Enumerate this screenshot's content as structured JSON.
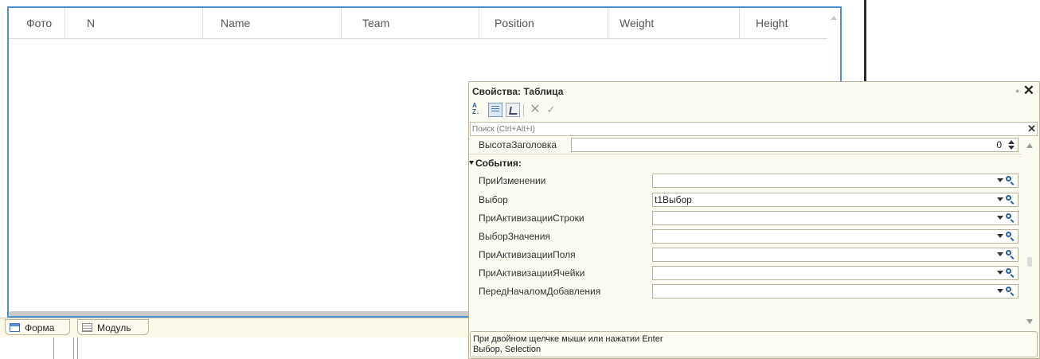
{
  "table": {
    "columns": [
      "Фото",
      "N",
      "Name",
      "Team",
      "Position",
      "Weight",
      "Height"
    ]
  },
  "tabs": {
    "form_label": "Форма",
    "module_label": "Модуль"
  },
  "properties": {
    "title": "Свойства: Таблица",
    "search_placeholder": "Поиск (Ctrl+Alt+I)",
    "header_height": {
      "label": "ВысотаЗаголовка",
      "value": "0"
    },
    "events_group_label": "События:",
    "events": [
      {
        "label": "ПриИзменении",
        "value": ""
      },
      {
        "label": "Выбор",
        "value": "t1Выбор"
      },
      {
        "label": "ПриАктивизацииСтроки",
        "value": ""
      },
      {
        "label": "ВыборЗначения",
        "value": ""
      },
      {
        "label": "ПриАктивизацииПоля",
        "value": ""
      },
      {
        "label": "ПриАктивизацииЯчейки",
        "value": ""
      },
      {
        "label": "ПередНачаломДобавления",
        "value": ""
      }
    ],
    "description": {
      "line1": "При двойном щелчке мыши или нажатии Enter",
      "line2": "Выбор, Selection"
    }
  }
}
